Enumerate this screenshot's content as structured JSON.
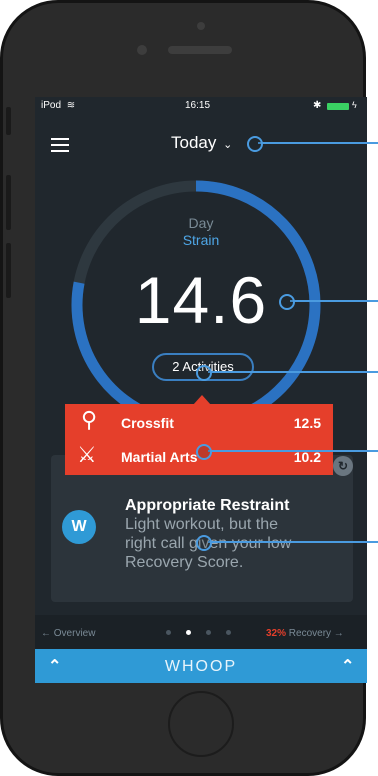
{
  "status_bar": {
    "carrier": "iPod",
    "time": "16:15"
  },
  "header": {
    "title": "Today"
  },
  "strain": {
    "label_line1": "Day",
    "label_line2": "Strain",
    "value": "14.6",
    "fraction": 0.78
  },
  "activities_pill": {
    "label": "2 Activities"
  },
  "activities": [
    {
      "name": "Crossfit",
      "score": "12.5"
    },
    {
      "name": "Martial Arts",
      "score": "10.2"
    }
  ],
  "recommendation": {
    "title": "Appropriate Restraint",
    "text_line1": "Light workout, but the",
    "text_line2": "right call given your low",
    "text_line3": "Recovery Score."
  },
  "bottom_nav": {
    "left": "← Overview",
    "right_percent": "32%",
    "right_label": " Recovery →"
  },
  "whoop_bar": {
    "label": "WHOOP"
  },
  "colors": {
    "accent_blue": "#2f9ad6",
    "popup_red": "#e53f2b",
    "recovery_red": "#e53f2b"
  }
}
